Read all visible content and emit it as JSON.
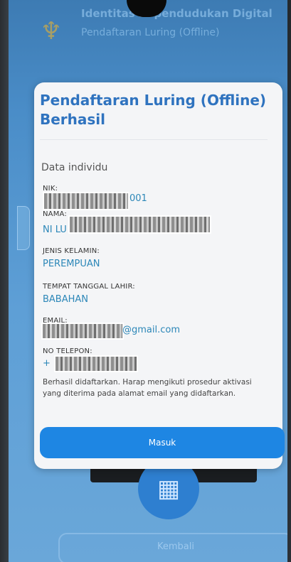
{
  "header": {
    "title": "Identitas Kependudukan Digital",
    "subtitle": "Pendaftaran Luring (Offline)"
  },
  "dialog": {
    "title_line1": "Pendaftaran Luring (Offline)",
    "title_line2": "Berhasil",
    "section_title": "Data individu",
    "nik_label": "NIK:",
    "nik_visible_suffix": "001",
    "nama_label": "NAMA:",
    "nama_visible_prefix": "NI LU",
    "jenis_kelamin_label": "JENIS KELAMIN:",
    "jenis_kelamin_value": "PEREMPUAN",
    "ttl_label": "TEMPAT TANGGAL LAHIR:",
    "ttl_value": "BABAHAN",
    "email_label": "EMAIL:",
    "email_visible_suffix": "@gmail.com",
    "telepon_label": "NO TELEPON:",
    "telepon_visible_prefix": "+",
    "note": "Berhasil didaftarkan. Harap mengikuti prosedur aktivasi yang diterima pada alamat email yang didaftarkan.",
    "button_label": "Masuk"
  },
  "background": {
    "kembali_label": "Kembali"
  }
}
